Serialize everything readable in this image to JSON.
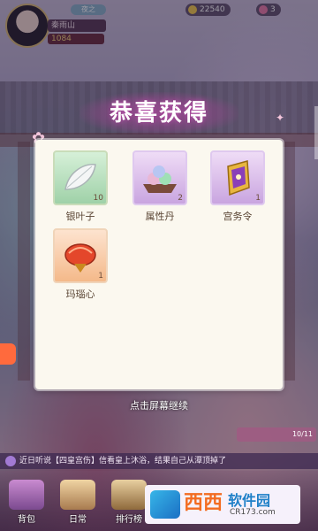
{
  "hud": {
    "player_name": "秦雨山",
    "power": "1084",
    "vip": "夜之",
    "resource_1": "22540",
    "resource_2": "3"
  },
  "popup": {
    "title": "恭喜获得",
    "continue_hint": "点击屏幕继续"
  },
  "rewards": [
    {
      "name": "银叶子",
      "count": "10",
      "icon": "silver-leaf-icon"
    },
    {
      "name": "属性丹",
      "count": "2",
      "icon": "attribute-pill-icon"
    },
    {
      "name": "宫务令",
      "count": "1",
      "icon": "palace-token-icon"
    },
    {
      "name": "玛瑙心",
      "count": "1",
      "icon": "agate-heart-icon"
    }
  ],
  "mission": {
    "count": "10/11"
  },
  "news": {
    "text": "近日听说【四皇宫伤】信看皇上沐浴，结果自己从潭顶掉了"
  },
  "bottom_nav": [
    {
      "label": "背包"
    },
    {
      "label": "日常"
    },
    {
      "label": "排行榜"
    }
  ],
  "watermark": {
    "brand": "西西",
    "name": "软件园",
    "url": "CR173.com"
  },
  "colors": {
    "panel_bg": "#fbf8ef",
    "title_glow": "#c45ab6",
    "slot_green": "#9fd1a8",
    "slot_purple": "#c9a5e0",
    "slot_orange": "#f4b98a"
  }
}
